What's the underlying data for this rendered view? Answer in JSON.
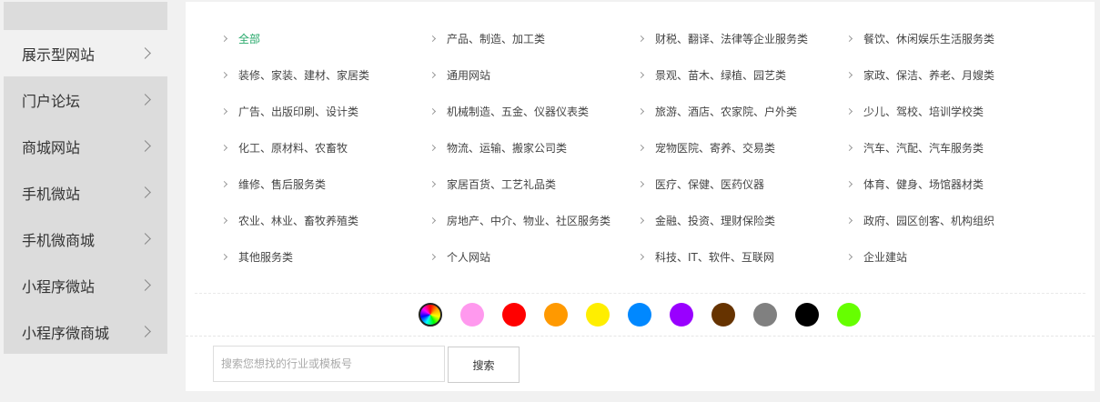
{
  "sidebar": {
    "items": [
      {
        "label": "展示型网站"
      },
      {
        "label": "门户论坛"
      },
      {
        "label": "商城网站"
      },
      {
        "label": "手机微站"
      },
      {
        "label": "手机微商城"
      },
      {
        "label": "小程序微站"
      },
      {
        "label": "小程序微商城"
      }
    ]
  },
  "categories": [
    [
      "全部",
      "产品、制造、加工类",
      "财税、翻译、法律等企业服务类",
      "餐饮、休闲娱乐生活服务类"
    ],
    [
      "装修、家装、建材、家居类",
      "通用网站",
      "景观、苗木、绿植、园艺类",
      "家政、保洁、养老、月嫂类"
    ],
    [
      "广告、出版印刷、设计类",
      "机械制造、五金、仪器仪表类",
      "旅游、酒店、农家院、户外类",
      "少儿、驾校、培训学校类"
    ],
    [
      "化工、原材料、农畜牧",
      "物流、运输、搬家公司类",
      "宠物医院、寄养、交易类",
      "汽车、汽配、汽车服务类"
    ],
    [
      "维修、售后服务类",
      "家居百货、工艺礼品类",
      "医疗、保健、医药仪器",
      "体育、健身、场馆器材类"
    ],
    [
      "农业、林业、畜牧养殖类",
      "房地产、中介、物业、社区服务类",
      "金融、投资、理财保险类",
      "政府、园区创客、机构组织"
    ],
    [
      "其他服务类",
      "个人网站",
      "科技、IT、软件、互联网",
      "企业建站"
    ]
  ],
  "active_category": "全部",
  "active_category_color": "#26a86a",
  "colors": [
    "rainbow",
    "#ff99ee",
    "#ff0000",
    "#ff9900",
    "#ffee00",
    "#0088ff",
    "#9900ff",
    "#663300",
    "#808080",
    "#000000",
    "#66ff00"
  ],
  "search": {
    "placeholder": "搜索您想找的行业或模板号",
    "value": "",
    "button_label": "搜索"
  }
}
